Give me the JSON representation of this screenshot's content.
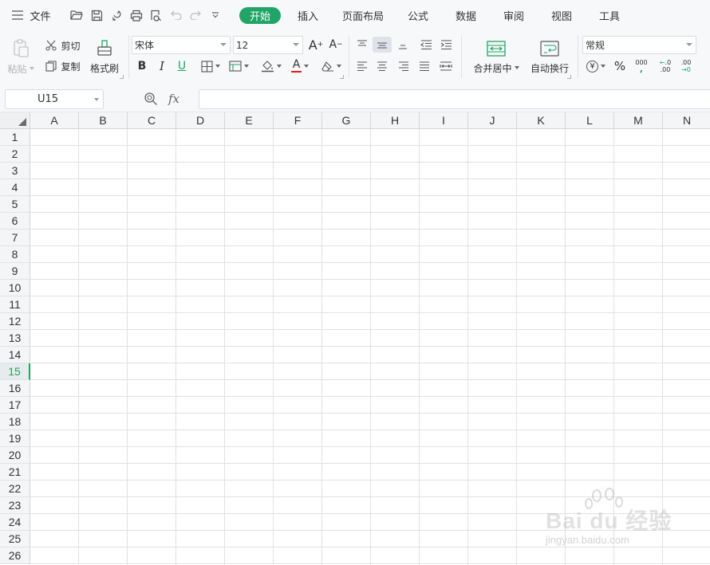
{
  "menubar": {
    "file_label": "文件",
    "tabs": [
      {
        "label": "开始",
        "active": true
      },
      {
        "label": "插入",
        "active": false
      },
      {
        "label": "页面布局",
        "active": false
      },
      {
        "label": "公式",
        "active": false
      },
      {
        "label": "数据",
        "active": false
      },
      {
        "label": "审阅",
        "active": false
      },
      {
        "label": "视图",
        "active": false
      },
      {
        "label": "工具",
        "active": false
      }
    ]
  },
  "ribbon": {
    "paste_label": "粘贴",
    "cut_label": "剪切",
    "copy_label": "复制",
    "format_painter_label": "格式刷",
    "font_name": "宋体",
    "font_size": "12",
    "bold_label": "B",
    "italic_label": "I",
    "underline_label": "U",
    "font_color_label": "A",
    "font_grow_label": "A",
    "font_shrink_label": "A",
    "merge_center_label": "合并居中",
    "wrap_text_label": "自动换行",
    "number_format": "常规",
    "percent_label": "%",
    "thousands_label": "000",
    "inc_decimal_top": ".0",
    "inc_decimal_bottom": ".00",
    "dec_decimal_top": ".00",
    "dec_decimal_bottom": "→0",
    "currency_symbol": "¥"
  },
  "formula_bar": {
    "cell_ref": "U15",
    "fx_label": "fx",
    "formula_value": ""
  },
  "sheet": {
    "columns": [
      "A",
      "B",
      "C",
      "D",
      "E",
      "F",
      "G",
      "H",
      "I",
      "J",
      "K",
      "L",
      "M",
      "N"
    ],
    "rows": [
      "1",
      "2",
      "3",
      "4",
      "5",
      "6",
      "7",
      "8",
      "9",
      "10",
      "11",
      "12",
      "13",
      "14",
      "15",
      "16",
      "17",
      "18",
      "19",
      "20",
      "21",
      "22",
      "23",
      "24",
      "25",
      "26"
    ],
    "active_row": "15"
  },
  "watermark": {
    "brand": "Bai du 经验",
    "url": "jingyan.baidu.com"
  },
  "colors": {
    "accent": "#21a567",
    "font_color_underline": "#e02020"
  }
}
